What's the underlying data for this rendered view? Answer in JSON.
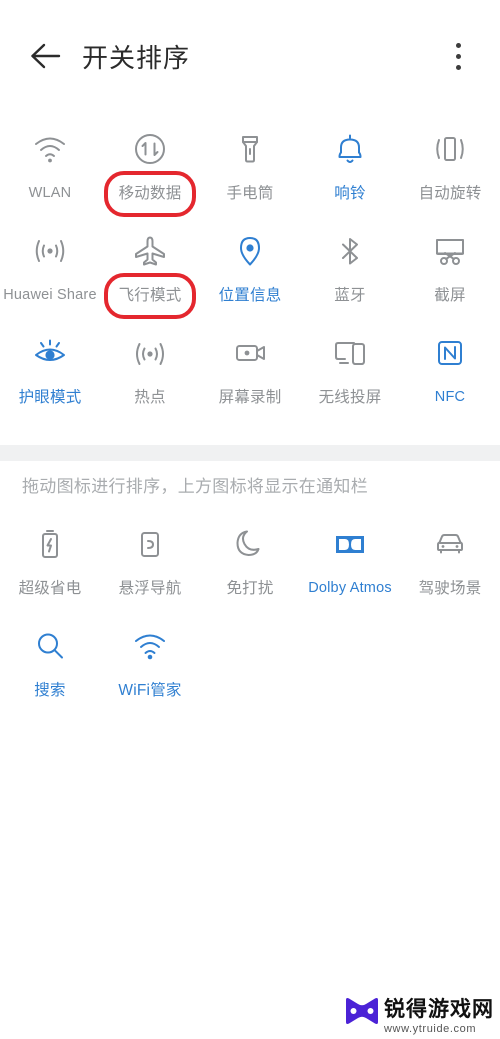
{
  "header": {
    "back_icon": "arrow-left-icon",
    "title": "开关排序",
    "more_icon": "more-vertical-icon"
  },
  "colors": {
    "accent_blue": "#2f7fd1",
    "inactive_gray": "#8e9194",
    "annotation_red": "#e4272e",
    "divider_gray": "#f0f1f2",
    "hint_gray": "#a9acaf"
  },
  "top_section": {
    "tiles": [
      {
        "label": "WLAN",
        "icon": "wifi-icon",
        "active": false,
        "latin": true,
        "highlighted": false
      },
      {
        "label": "移动数据",
        "icon": "mobile-data-icon",
        "active": false,
        "latin": false,
        "highlighted": true
      },
      {
        "label": "手电筒",
        "icon": "flashlight-icon",
        "active": false,
        "latin": false,
        "highlighted": false
      },
      {
        "label": "响铃",
        "icon": "bell-icon",
        "active": true,
        "latin": false,
        "highlighted": false
      },
      {
        "label": "自动旋转",
        "icon": "auto-rotate-icon",
        "active": false,
        "latin": false,
        "highlighted": false
      },
      {
        "label": "Huawei Share",
        "icon": "huawei-share-icon",
        "active": false,
        "latin": true,
        "highlighted": false
      },
      {
        "label": "飞行模式",
        "icon": "airplane-icon",
        "active": false,
        "latin": false,
        "highlighted": true
      },
      {
        "label": "位置信息",
        "icon": "location-pin-icon",
        "active": true,
        "latin": false,
        "highlighted": false
      },
      {
        "label": "蓝牙",
        "icon": "bluetooth-icon",
        "active": false,
        "latin": false,
        "highlighted": false
      },
      {
        "label": "截屏",
        "icon": "screenshot-icon",
        "active": false,
        "latin": false,
        "highlighted": false
      },
      {
        "label": "护眼模式",
        "icon": "eye-comfort-icon",
        "active": true,
        "latin": false,
        "highlighted": false
      },
      {
        "label": "热点",
        "icon": "hotspot-icon",
        "active": false,
        "latin": false,
        "highlighted": false
      },
      {
        "label": "屏幕录制",
        "icon": "screen-record-icon",
        "active": false,
        "latin": false,
        "highlighted": false
      },
      {
        "label": "无线投屏",
        "icon": "cast-icon",
        "active": false,
        "latin": false,
        "highlighted": false
      },
      {
        "label": "NFC",
        "icon": "nfc-icon",
        "active": true,
        "latin": true,
        "highlighted": false
      }
    ]
  },
  "hint": "拖动图标进行排序，上方图标将显示在通知栏",
  "bottom_section": {
    "tiles": [
      {
        "label": "超级省电",
        "icon": "battery-saver-icon",
        "active": false,
        "latin": false
      },
      {
        "label": "悬浮导航",
        "icon": "floating-nav-icon",
        "active": false,
        "latin": false
      },
      {
        "label": "免打扰",
        "icon": "do-not-disturb-icon",
        "active": false,
        "latin": false
      },
      {
        "label": "Dolby Atmos",
        "icon": "dolby-atmos-icon",
        "active": true,
        "latin": true
      },
      {
        "label": "驾驶场景",
        "icon": "car-mode-icon",
        "active": false,
        "latin": false
      },
      {
        "label": "搜索",
        "icon": "search-icon",
        "active": true,
        "latin": false
      },
      {
        "label": "WiFi管家",
        "icon": "wifi-manager-icon",
        "active": true,
        "latin": false
      }
    ]
  },
  "watermark": {
    "name": "锐得游戏网",
    "url": "www.ytruide.com",
    "logo_icon": "bowtie-logo-icon"
  }
}
